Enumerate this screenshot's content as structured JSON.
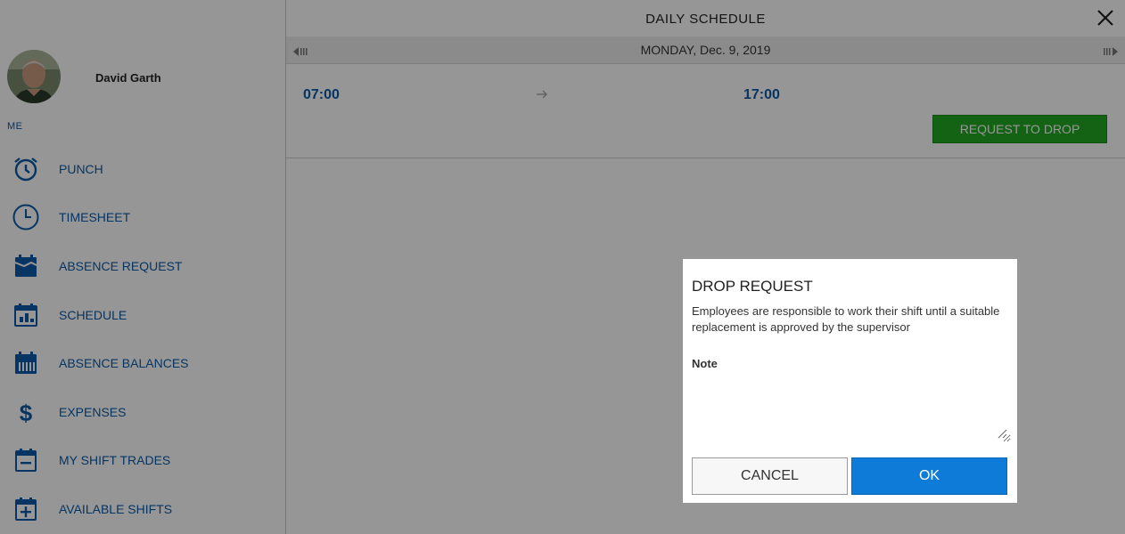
{
  "user": {
    "name": "David Garth",
    "section_label": "ME"
  },
  "nav": {
    "items": [
      {
        "label": "PUNCH",
        "icon": "alarm-clock-icon"
      },
      {
        "label": "TIMESHEET",
        "icon": "clock-icon"
      },
      {
        "label": "ABSENCE REQUEST",
        "icon": "calendar-leave-icon"
      },
      {
        "label": "SCHEDULE",
        "icon": "calendar-schedule-icon"
      },
      {
        "label": "ABSENCE BALANCES",
        "icon": "calendar-balance-icon"
      },
      {
        "label": "EXPENSES",
        "icon": "dollar-icon"
      },
      {
        "label": "MY SHIFT TRADES",
        "icon": "calendar-minus-icon"
      },
      {
        "label": "AVAILABLE SHIFTS",
        "icon": "calendar-plus-icon"
      }
    ]
  },
  "header": {
    "title": "DAILY SCHEDULE"
  },
  "date_bar": {
    "date": "MONDAY, Dec. 9, 2019"
  },
  "shift": {
    "start": "07:00",
    "end": "17:00",
    "drop_label": "REQUEST TO DROP"
  },
  "modal": {
    "title": "DROP REQUEST",
    "description": "Employees are responsible to work their shift until a suitable replacement is approved by the supervisor",
    "note_label": "Note",
    "note_value": "",
    "cancel_label": "CANCEL",
    "ok_label": "OK"
  },
  "colors": {
    "accent": "#0b5aa8",
    "drop_button": "#22a922",
    "ok_button": "#0e7bd8"
  }
}
